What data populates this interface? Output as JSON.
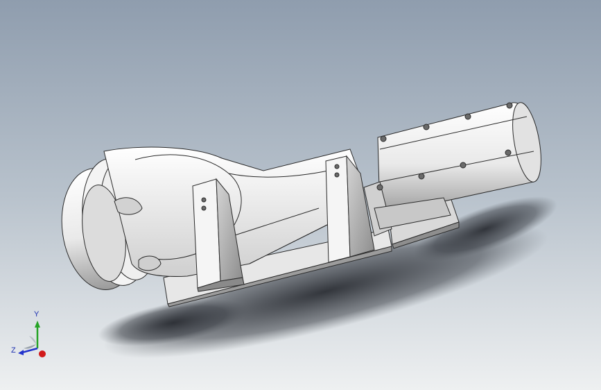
{
  "view": {
    "background_top": "#8f9dae",
    "background_bottom": "#eef0f1",
    "model_fill": "#f2f2f2",
    "edge_color": "#2a2a2a"
  },
  "triad": {
    "y_label": "Y",
    "z_label": "Z",
    "y_axis_color": "#25a325",
    "z_axis_color": "#2233cc",
    "x_axis_color": "#d11a1a"
  }
}
